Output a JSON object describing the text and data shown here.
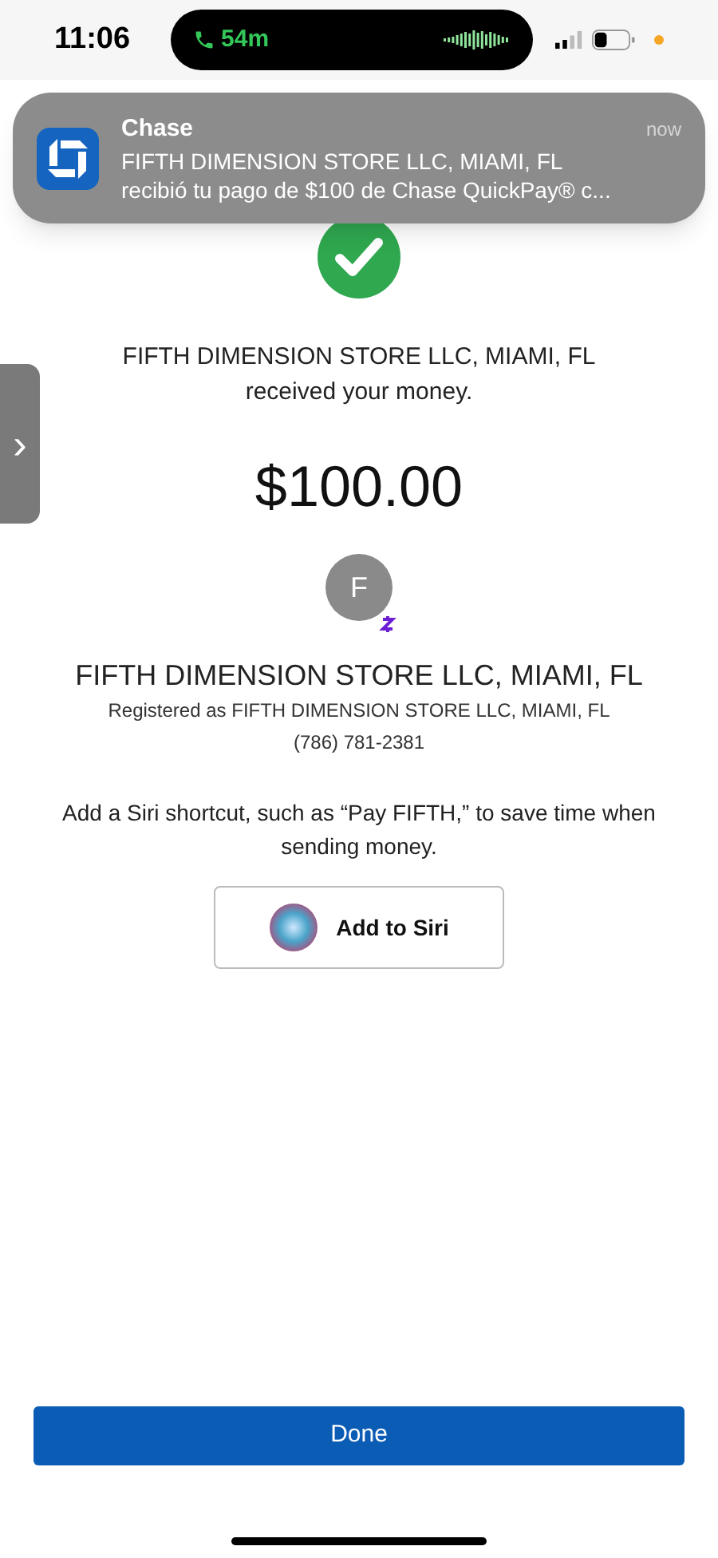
{
  "status_bar": {
    "time": "11:06",
    "call_duration": "54m"
  },
  "notification": {
    "app": "Chase",
    "time": "now",
    "line_1": "FIFTH DIMENSION STORE LLC, MIAMI, FL",
    "line_2": "recibió tu pago de $100 de Chase QuickPay® c..."
  },
  "side_tab": {
    "glyph": "›"
  },
  "confirmation": {
    "message": "FIFTH DIMENSION STORE LLC, MIAMI, FL received your money.",
    "amount": "$100.00"
  },
  "recipient": {
    "initial": "F",
    "name": "FIFTH DIMENSION STORE LLC, MIAMI, FL",
    "registered": "Registered as FIFTH DIMENSION STORE LLC, MIAMI, FL",
    "phone": "(786) 781-2381"
  },
  "siri": {
    "hint": "Add a Siri shortcut, such as “Pay FIFTH,” to save time when sending money.",
    "button": "Add to Siri"
  },
  "done_button": "Done"
}
